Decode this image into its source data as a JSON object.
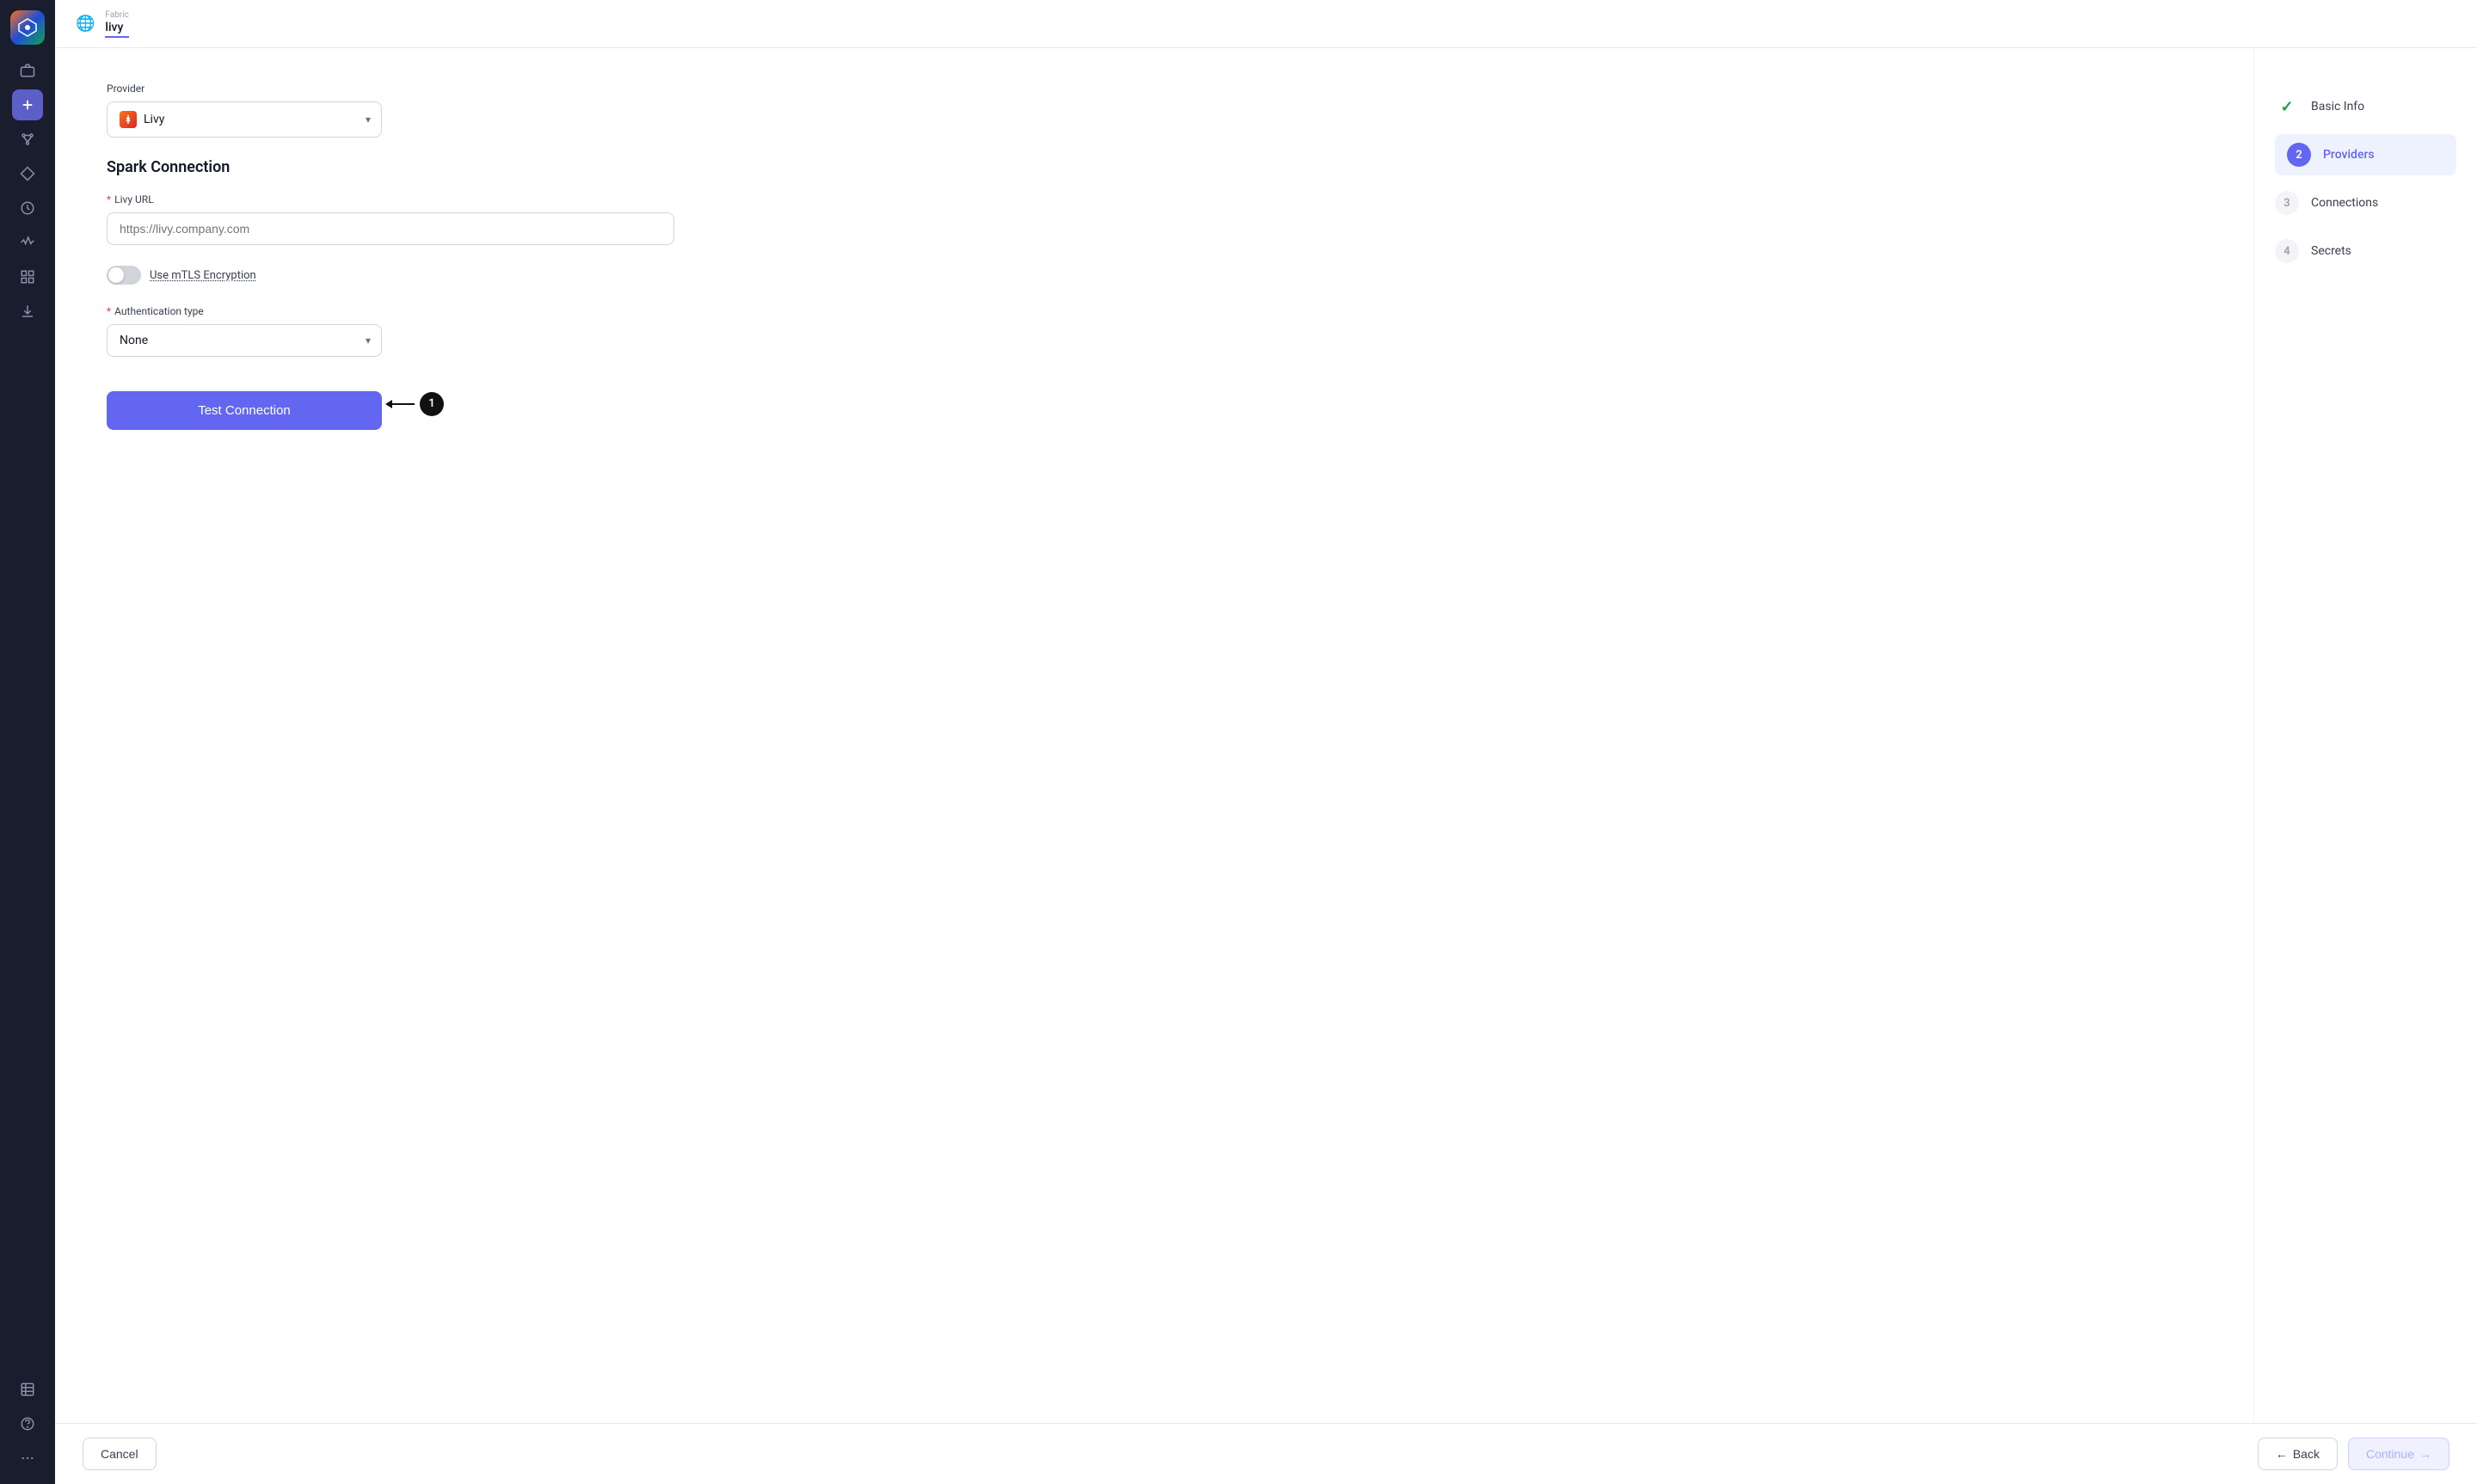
{
  "sidebar": {
    "icons": [
      {
        "name": "logo",
        "symbol": "⬡"
      },
      {
        "name": "camera-icon",
        "symbol": "⊞"
      },
      {
        "name": "add-icon",
        "symbol": "+"
      },
      {
        "name": "nodes-icon",
        "symbol": "⛶"
      },
      {
        "name": "diamond-icon",
        "symbol": "◇"
      },
      {
        "name": "clock-icon",
        "symbol": "○"
      },
      {
        "name": "activity-icon",
        "symbol": "∿"
      },
      {
        "name": "grid-icon",
        "symbol": "⊞"
      },
      {
        "name": "download-icon",
        "symbol": "↓"
      },
      {
        "name": "table-icon",
        "symbol": "▦"
      },
      {
        "name": "help-icon",
        "symbol": "?"
      },
      {
        "name": "more-icon",
        "symbol": "···"
      }
    ]
  },
  "header": {
    "fabric_label": "Fabric",
    "title": "livy",
    "globe_icon": "🌐"
  },
  "form": {
    "provider_label": "Provider",
    "provider_value": "Livy",
    "section_title": "Spark Connection",
    "livy_url_label": "Livy URL",
    "livy_url_placeholder": "https://livy.company.com",
    "mtls_label": "Use mTLS Encryption",
    "auth_type_label": "Authentication type",
    "auth_type_value": "None",
    "test_button_label": "Test Connection"
  },
  "stepper": {
    "steps": [
      {
        "number": "✓",
        "label": "Basic Info",
        "state": "completed"
      },
      {
        "number": "2",
        "label": "Providers",
        "state": "active"
      },
      {
        "number": "3",
        "label": "Connections",
        "state": "inactive"
      },
      {
        "number": "4",
        "label": "Secrets",
        "state": "inactive"
      }
    ]
  },
  "footer": {
    "cancel_label": "Cancel",
    "back_label": "Back",
    "continue_label": "Continue",
    "back_arrow": "←",
    "continue_arrow": "→"
  },
  "annotation": {
    "badge": "1"
  }
}
